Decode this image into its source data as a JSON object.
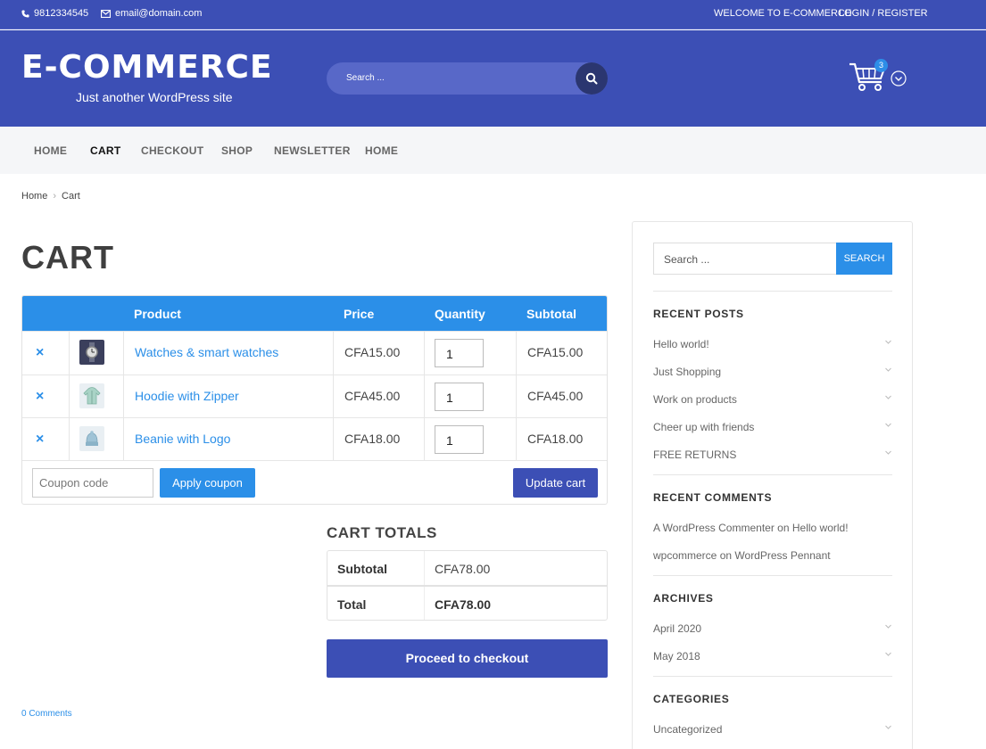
{
  "topbar": {
    "phone": "9812334545",
    "email": "email@domain.com",
    "welcome": "WELCOME TO E-COMMERCE",
    "login": "LOGIN / REGISTER"
  },
  "header": {
    "logo": "E-COMMERCE",
    "tagline": "Just another WordPress site",
    "search_placeholder": "Search ...",
    "cart_count": "3"
  },
  "nav": [
    "HOME",
    "CART",
    "CHECKOUT",
    "SHOP",
    "NEWSLETTER",
    "HOME"
  ],
  "nav_active": "CART",
  "breadcrumb": {
    "home": "Home",
    "current": "Cart"
  },
  "page_title": "CART",
  "cart": {
    "columns": [
      "Product",
      "Price",
      "Quantity",
      "Subtotal"
    ],
    "items": [
      {
        "name": "Watches & smart watches",
        "price": "CFA15.00",
        "qty": "1",
        "subtotal": "CFA15.00"
      },
      {
        "name": "Hoodie with Zipper",
        "price": "CFA45.00",
        "qty": "1",
        "subtotal": "CFA45.00"
      },
      {
        "name": "Beanie with Logo",
        "price": "CFA18.00",
        "qty": "1",
        "subtotal": "CFA18.00"
      }
    ],
    "remove_symbol": "×",
    "coupon_placeholder": "Coupon code",
    "apply_label": "Apply coupon",
    "update_label": "Update cart"
  },
  "totals": {
    "title": "CART TOTALS",
    "subtotal_label": "Subtotal",
    "subtotal_value": "CFA78.00",
    "total_label": "Total",
    "total_value": "CFA78.00",
    "checkout_label": "Proceed to checkout"
  },
  "comments_link": "0 Comments",
  "sidebar": {
    "search_placeholder": "Search ...",
    "search_button": "SEARCH",
    "recent_posts_title": "RECENT POSTS",
    "recent_posts": [
      "Hello world!",
      "Just Shopping",
      "Work on products",
      "Cheer up with friends",
      "FREE RETURNS"
    ],
    "recent_comments_title": "RECENT COMMENTS",
    "recent_comments": [
      {
        "author": "A WordPress Commenter",
        "on": "on",
        "post": "Hello world!"
      },
      {
        "author": "wpcommerce",
        "on": "on",
        "post": "WordPress Pennant"
      }
    ],
    "archives_title": "ARCHIVES",
    "archives": [
      "April 2020",
      "May 2018"
    ],
    "categories_title": "CATEGORIES",
    "categories": [
      "Uncategorized"
    ]
  },
  "colors": {
    "brand": "#3c4fb5",
    "accent": "#2b8fe8",
    "dark_button": "#2b3670"
  }
}
